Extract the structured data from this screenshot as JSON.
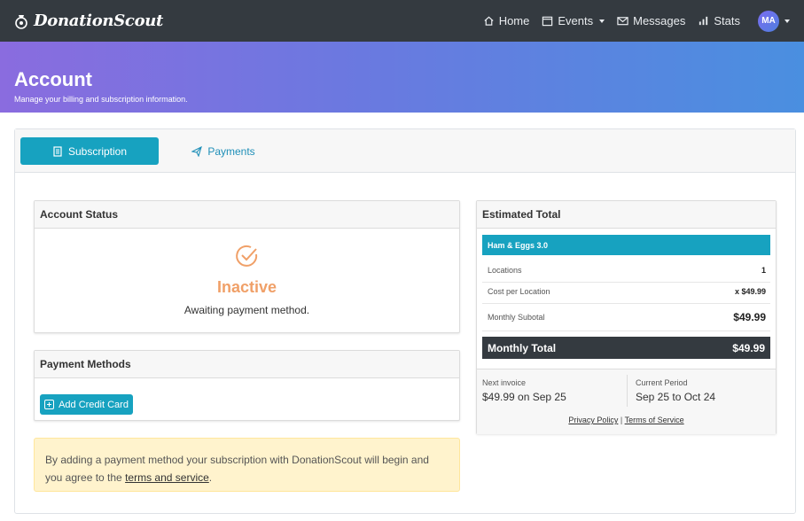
{
  "nav": {
    "brand": "DonationScout",
    "links": [
      {
        "label": "Home",
        "icon": "home-icon"
      },
      {
        "label": "Events",
        "icon": "calendar-icon"
      },
      {
        "label": "Messages",
        "icon": "envelope-icon"
      },
      {
        "label": "Stats",
        "icon": "bar-chart-icon"
      }
    ],
    "avatar_initials": "MA"
  },
  "header": {
    "title": "Account",
    "subtitle": "Manage your billing and subscription information."
  },
  "tabs": [
    {
      "label": "Subscription",
      "active": true
    },
    {
      "label": "Payments",
      "active": false
    }
  ],
  "account_status": {
    "heading": "Account Status",
    "status": "Inactive",
    "message": "Awaiting payment method."
  },
  "payment_methods": {
    "heading": "Payment Methods",
    "add_button": "Add Credit Card"
  },
  "alert": {
    "text": "By adding a payment method your subscription with DonationScout will begin and you agree to the",
    "link": "terms and service",
    "suffix": "."
  },
  "estimate": {
    "heading": "Estimated Total",
    "plan": "Ham & Eggs 3.0",
    "rows": [
      {
        "label": "Locations",
        "value": "1"
      },
      {
        "label": "Cost per Location",
        "value": "x $49.99"
      },
      {
        "label": "Monthly Subotal",
        "value": "$49.99"
      }
    ],
    "total_label": "Monthly Total",
    "total_value": "$49.99",
    "next_invoice_label": "Next invoice",
    "next_invoice_value": "$49.99 on Sep 25",
    "current_period_label": "Current Period",
    "current_period_value": "Sep 25 to Oct 24",
    "privacy_link": "Privacy Policy",
    "separator": "|",
    "terms_link": "Terms of Service"
  },
  "colors": {
    "accent": "#17a2c0",
    "navbar": "#343a40",
    "status_inactive": "#f0a068",
    "alert_bg": "#fff3cd"
  }
}
